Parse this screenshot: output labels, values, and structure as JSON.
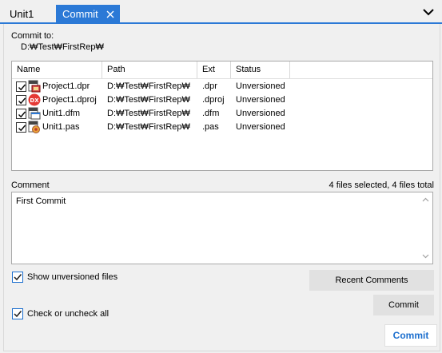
{
  "tabs": [
    {
      "label": "Unit1",
      "active": false
    },
    {
      "label": "Commit",
      "active": true
    }
  ],
  "commit_to": {
    "label": "Commit to:",
    "path": "D:₩Test₩FirstRep₩"
  },
  "grid": {
    "columns": [
      "Name",
      "Path",
      "Ext",
      "Status"
    ],
    "rows": [
      {
        "checked": true,
        "icon": "dpr-project-icon",
        "name": "Project1.dpr",
        "path": "D:₩Test₩FirstRep₩",
        "ext": ".dpr",
        "status": "Unversioned"
      },
      {
        "checked": true,
        "icon": "dproj-delphi-icon",
        "name": "Project1.dproj",
        "path": "D:₩Test₩FirstRep₩",
        "ext": ".dproj",
        "status": "Unversioned"
      },
      {
        "checked": true,
        "icon": "dfm-form-icon",
        "name": "Unit1.dfm",
        "path": "D:₩Test₩FirstRep₩",
        "ext": ".dfm",
        "status": "Unversioned"
      },
      {
        "checked": true,
        "icon": "pas-unit-icon",
        "name": "Unit1.pas",
        "path": "D:₩Test₩FirstRep₩",
        "ext": ".pas",
        "status": "Unversioned"
      }
    ]
  },
  "comment": {
    "label": "Comment",
    "summary": "4 files selected, 4 files total",
    "value": "First Commit"
  },
  "options": {
    "show_unversioned": {
      "label": "Show unversioned files",
      "checked": true
    },
    "check_all": {
      "label": "Check or uncheck all",
      "checked": true
    }
  },
  "buttons": {
    "recent_comments": "Recent Comments",
    "commit_secondary": "Commit",
    "commit_primary": "Commit"
  },
  "colors": {
    "accent": "#2b79d6",
    "primary_text": "#1c6fce"
  }
}
